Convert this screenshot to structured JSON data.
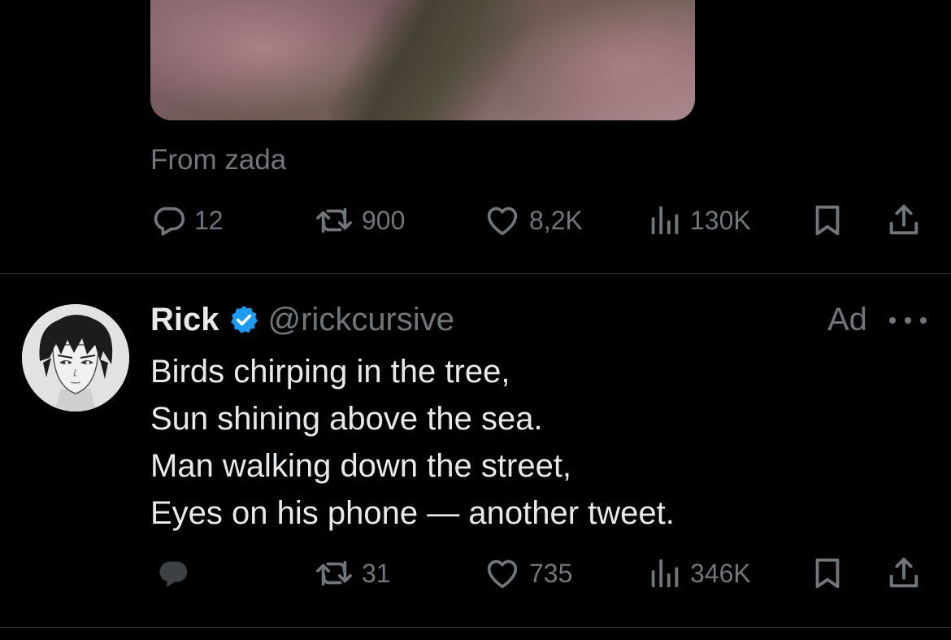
{
  "first_tweet": {
    "source_line": "From zada",
    "media": {
      "mute_icon": "speaker-muted-icon"
    },
    "actions": {
      "replies": "12",
      "reposts": "900",
      "likes": "8,2K",
      "views": "130K"
    }
  },
  "second_tweet": {
    "author": {
      "display_name": "Rick",
      "handle": "@rickcursive",
      "verified": true,
      "verified_color": "#1d9bf0"
    },
    "ad_label": "Ad",
    "text_lines": [
      "Birds chirping in the tree,",
      "Sun shining above the sea.",
      "Man walking down the street,",
      "Eyes on his phone — another tweet."
    ],
    "actions": {
      "replies": "",
      "reposts": "31",
      "likes": "735",
      "views": "346K"
    }
  },
  "colors": {
    "background": "#000000",
    "text_primary": "#e7e9ea",
    "text_secondary": "#71767b",
    "divider": "#2f3336"
  },
  "icons": [
    "reply-icon",
    "repost-icon",
    "like-icon",
    "views-icon",
    "bookmark-icon",
    "share-icon",
    "more-icon",
    "verified-badge-icon"
  ]
}
